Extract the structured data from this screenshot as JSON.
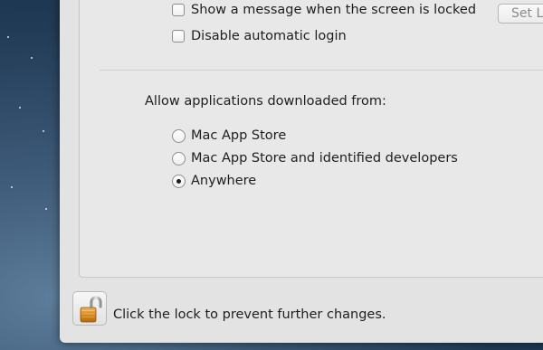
{
  "security": {
    "show_message_label": "Show a message when the screen is locked",
    "set_lock_label": "Set Lock",
    "disable_login_label": "Disable automatic login",
    "allow_heading": "Allow applications downloaded from:",
    "options": [
      {
        "label": "Mac App Store",
        "selected": false
      },
      {
        "label": "Mac App Store and identified developers",
        "selected": false
      },
      {
        "label": "Anywhere",
        "selected": true
      }
    ]
  },
  "footer": {
    "lock_icon": "unlocked-padlock-icon",
    "lock_text": "Click the lock to prevent further changes."
  }
}
